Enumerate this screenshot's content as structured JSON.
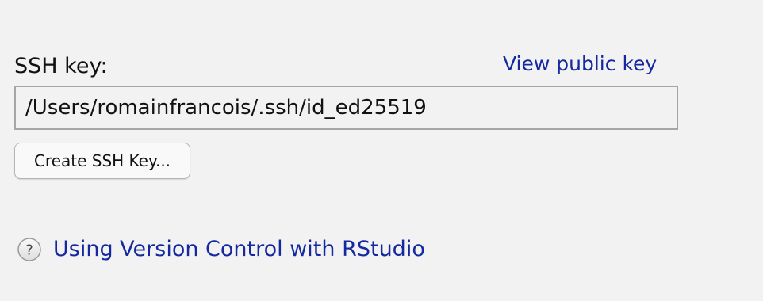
{
  "ssh": {
    "label": "SSH key:",
    "view_public_key_link": "View public key",
    "key_path": "/Users/romainfrancois/.ssh/id_ed25519",
    "create_button_label": "Create SSH Key..."
  },
  "help": {
    "icon": "help-question-icon",
    "link_text": "Using Version Control with RStudio"
  },
  "colors": {
    "background": "#f2f2f2",
    "link": "#1428a0",
    "field_border": "#a6a6a6"
  }
}
